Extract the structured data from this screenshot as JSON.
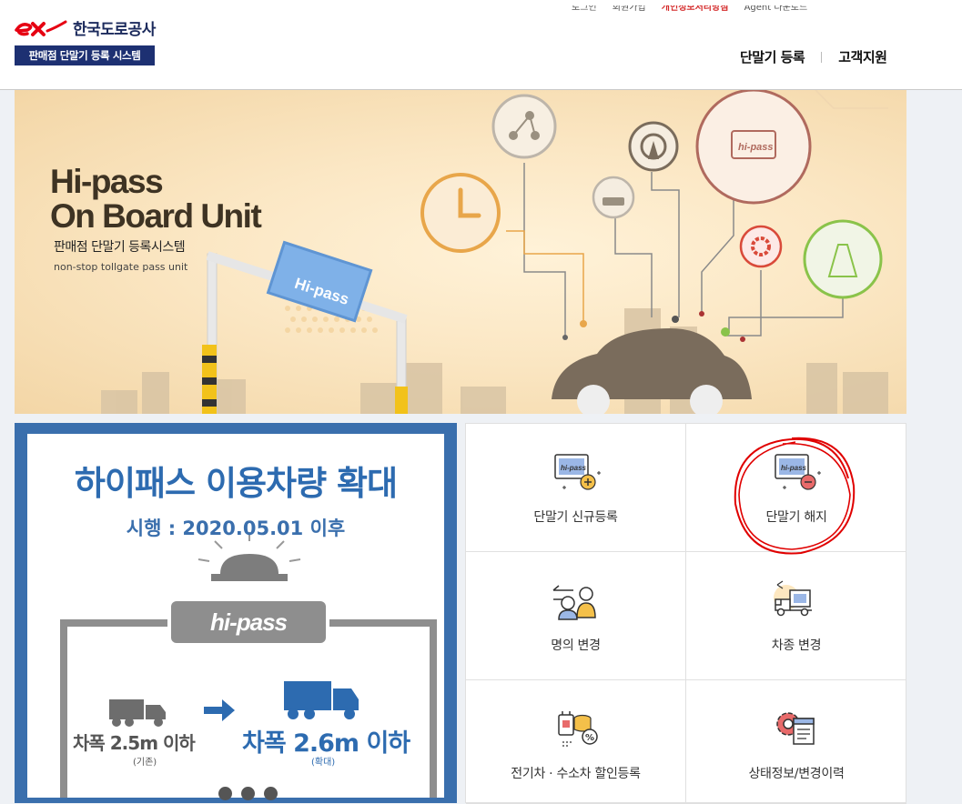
{
  "brand": {
    "logo_text": "한국도로공사",
    "system_name": "판매점 단말기 등록 시스템",
    "accent_color": "#1d3072",
    "logo_red": "#e60012"
  },
  "util_links": [
    {
      "label": "로그인"
    },
    {
      "label": "회원가입"
    },
    {
      "label": "개인정보처리방침",
      "highlight": true
    },
    {
      "label": "Agent 다운로드"
    }
  ],
  "gnb": {
    "items": [
      {
        "label": "단말기 등록"
      },
      {
        "label": "고객지원"
      }
    ]
  },
  "hero": {
    "title_line1": "Hi-pass",
    "title_line2": "On Board Unit",
    "subtitle": "판매점 단말기 등록시스템",
    "subtitle_en": "non-stop tollgate pass unit",
    "gate_sign": "Hi-pass",
    "badge_text": "hi-pass"
  },
  "promo": {
    "title": "하이패스 이용차량 확대",
    "date": "시행 : 2020.05.01 이후",
    "logo": "hi-pass",
    "old_size": "차폭 2.5m 이하",
    "old_note": "(기존)",
    "new_size": "차폭 2.6m 이하",
    "new_note": "(확대)",
    "slide_count": 3
  },
  "menu": [
    {
      "label": "단말기 신규등록",
      "icon": "card-plus-icon"
    },
    {
      "label": "단말기 해지",
      "icon": "card-minus-icon"
    },
    {
      "label": "명의 변경",
      "icon": "user-exchange-icon"
    },
    {
      "label": "차종 변경",
      "icon": "truck-exchange-icon"
    },
    {
      "label": "전기차 · 수소차 할인등록",
      "icon": "ev-discount-icon"
    },
    {
      "label": "상태정보/변경이력",
      "icon": "status-doc-icon"
    }
  ]
}
